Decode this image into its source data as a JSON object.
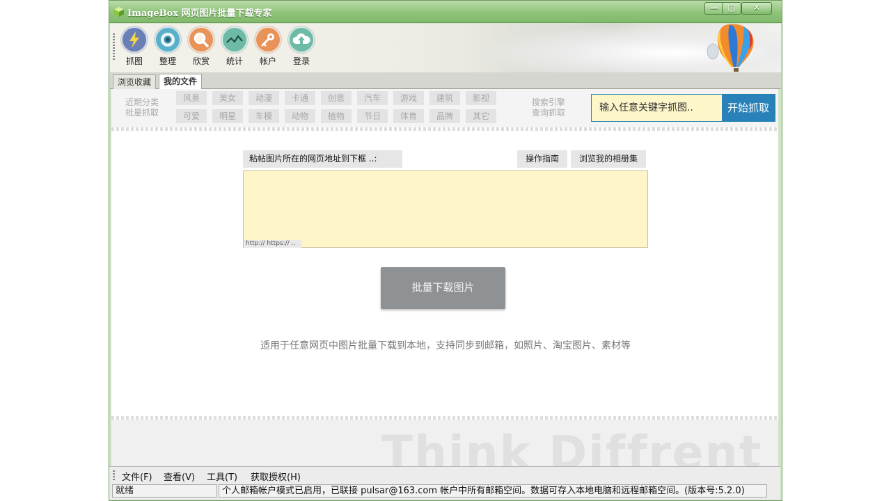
{
  "window": {
    "title": "ImageBox 网页图片批量下载专家",
    "controls": {
      "minimize": "—",
      "maximize": "□",
      "close": "✕"
    }
  },
  "toolbar": {
    "items": [
      {
        "label": "抓图",
        "icon": "lightning-icon",
        "color": "#6a7fb6"
      },
      {
        "label": "整理",
        "icon": "eye-icon",
        "color": "#5ab0c9"
      },
      {
        "label": "欣赏",
        "icon": "magnifier-icon",
        "color": "#e8935a"
      },
      {
        "label": "统计",
        "icon": "line-chart-icon",
        "color": "#6dbba7"
      },
      {
        "label": "帐户",
        "icon": "key-icon",
        "color": "#e8935a"
      },
      {
        "label": "登录",
        "icon": "cloud-upload-icon",
        "color": "#6dbba7"
      }
    ]
  },
  "tabs": [
    {
      "label": "浏览收藏",
      "active": false
    },
    {
      "label": "我的文件",
      "active": true
    }
  ],
  "categories": {
    "label_line1": "近期分类",
    "label_line2": "批量抓取",
    "row1": [
      "风景",
      "美女",
      "动漫",
      "卡通",
      "创意",
      "汽车",
      "游戏",
      "建筑",
      "影视"
    ],
    "row2": [
      "可爱",
      "明星",
      "车模",
      "动物",
      "植物",
      "节日",
      "体育",
      "品牌",
      "其它"
    ],
    "search_label_line1": "搜索引擎",
    "search_label_line2": "查询抓取"
  },
  "search": {
    "placeholder": "输入任意关键字抓图..",
    "button": "开始抓取"
  },
  "main": {
    "url_label": "粘帖图片所在的网页地址到下框 ..:",
    "guide_button": "操作指南",
    "album_button": "浏览我的相册集",
    "url_value": "",
    "url_hint": "http:// https:// ..",
    "download_button": "批量下载图片",
    "description": "适用于任意网页中图片批量下载到本地，支持同步到邮箱，如照片、淘宝图片、素材等",
    "watermark": "Think Diffrent"
  },
  "menu": [
    "文件(F)",
    "查看(V)",
    "工具(T)",
    "获取授权(H)"
  ],
  "status": {
    "state": "就绪",
    "message": "个人邮箱帐户模式已启用，已联接 pulsar@163.com 帐户中所有邮箱空间。数据可存入本地电脑和远程邮箱空间。(版本号:5.2.0)"
  }
}
